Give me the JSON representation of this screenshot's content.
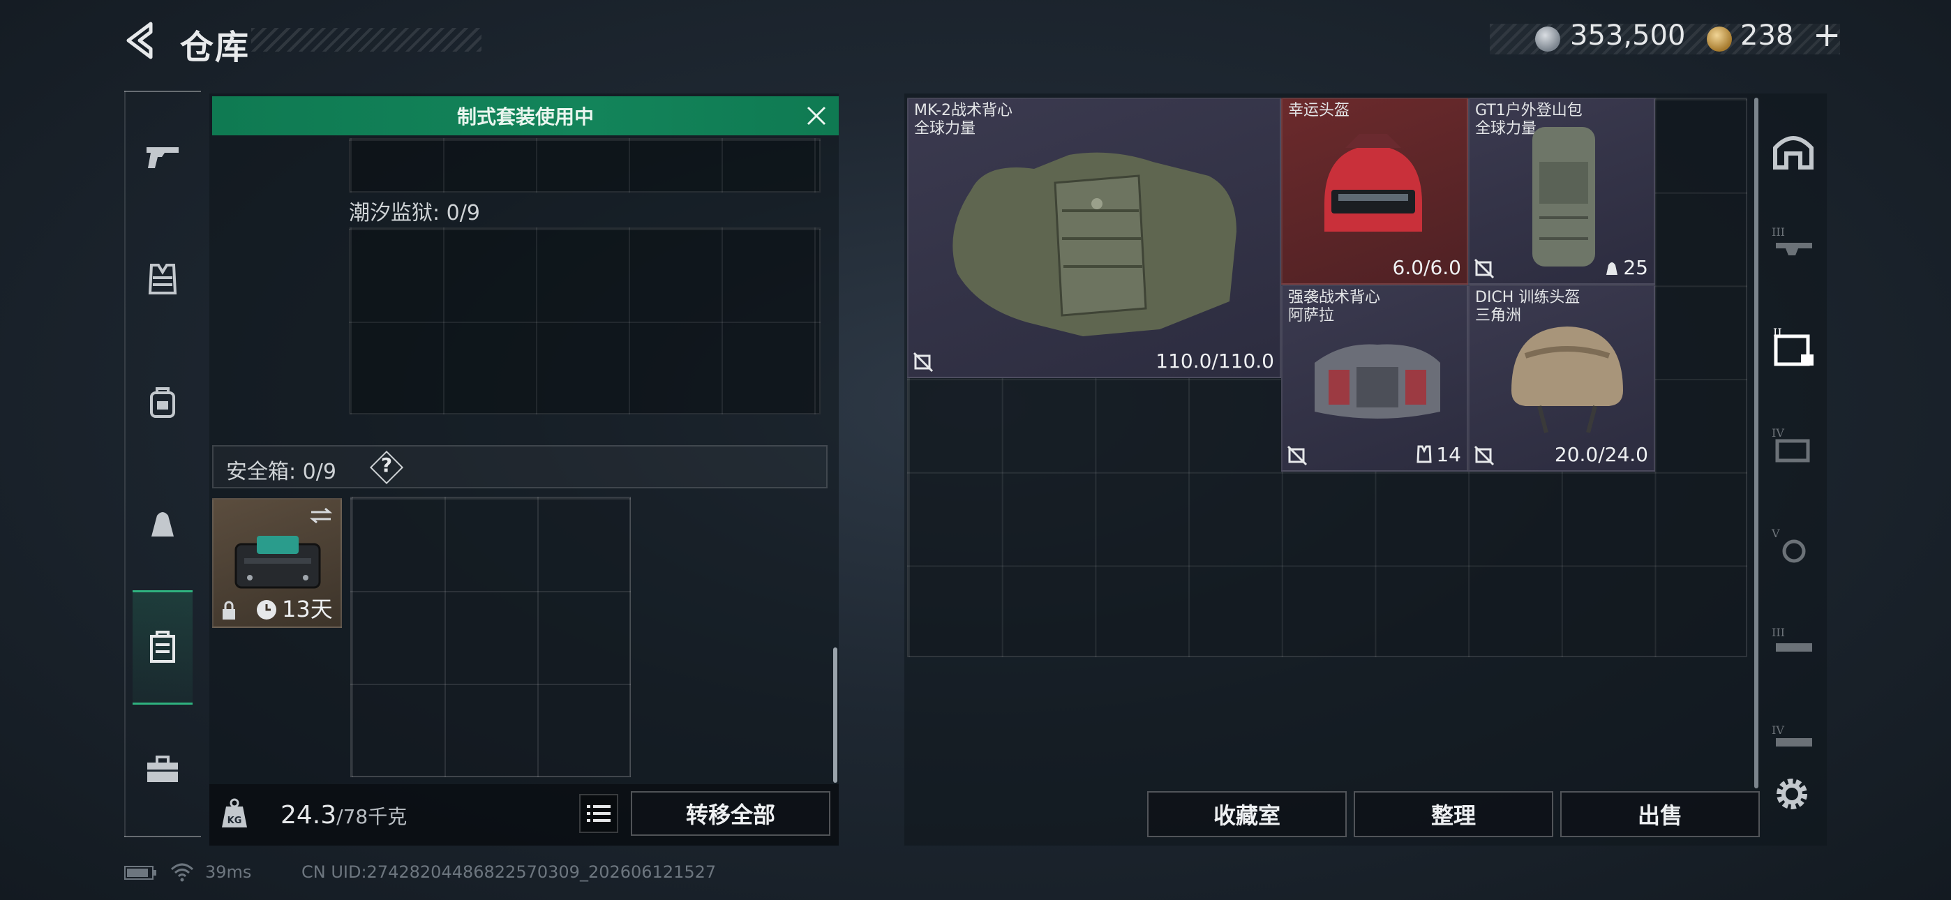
{
  "header": {
    "title": "仓库",
    "currency_silver": "353,500",
    "currency_gold": "238",
    "add_label": "+"
  },
  "left_nav": {
    "items": [
      "pistol-icon",
      "vest-icon",
      "backpack-icon",
      "pouch-icon",
      "safebox-icon",
      "toolbox-icon"
    ],
    "active_index": 4
  },
  "loadout": {
    "banner": "制式套装使用中",
    "prison_label": "潮汐监狱: 0/9",
    "safe_label": "安全箱: 0/9",
    "help": "?",
    "safebox_duration": "13天",
    "weight_current": "24.3",
    "weight_max": "/78千克",
    "transfer_all": "转移全部"
  },
  "storage_items": [
    {
      "name": "MK-2战术背心",
      "sub": "全球力量",
      "value": "110.0/110.0",
      "rarity": "purple"
    },
    {
      "name": "幸运头盔",
      "sub": "",
      "value": "6.0/6.0",
      "rarity": "red"
    },
    {
      "name": "GT1户外登山包",
      "sub": "全球力量",
      "value": "25",
      "rarity": "purple"
    },
    {
      "name": "强袭战术背心",
      "sub": "阿萨拉",
      "value": "14",
      "rarity": "purple"
    },
    {
      "name": "DICH 训练头盔",
      "sub": "三角洲",
      "value": "20.0/24.0",
      "rarity": "purple"
    }
  ],
  "right_tabs": [
    "bunker-icon",
    "tier-3-weapon-icon",
    "active-tier-icon",
    "tier-4-vest-icon",
    "tier-5-icon",
    "tier-3-item-icon",
    "tier-4-item-icon"
  ],
  "actions": {
    "collection": "收藏室",
    "organize": "整理",
    "sell": "出售"
  },
  "footer": {
    "ping": "39ms",
    "uid": "CN UID:2742820448682257030­9_202606121527"
  },
  "colors": {
    "accent_green": "#13845a",
    "rarity_purple": "#3b3a4f",
    "rarity_red": "#6b2a2c"
  }
}
